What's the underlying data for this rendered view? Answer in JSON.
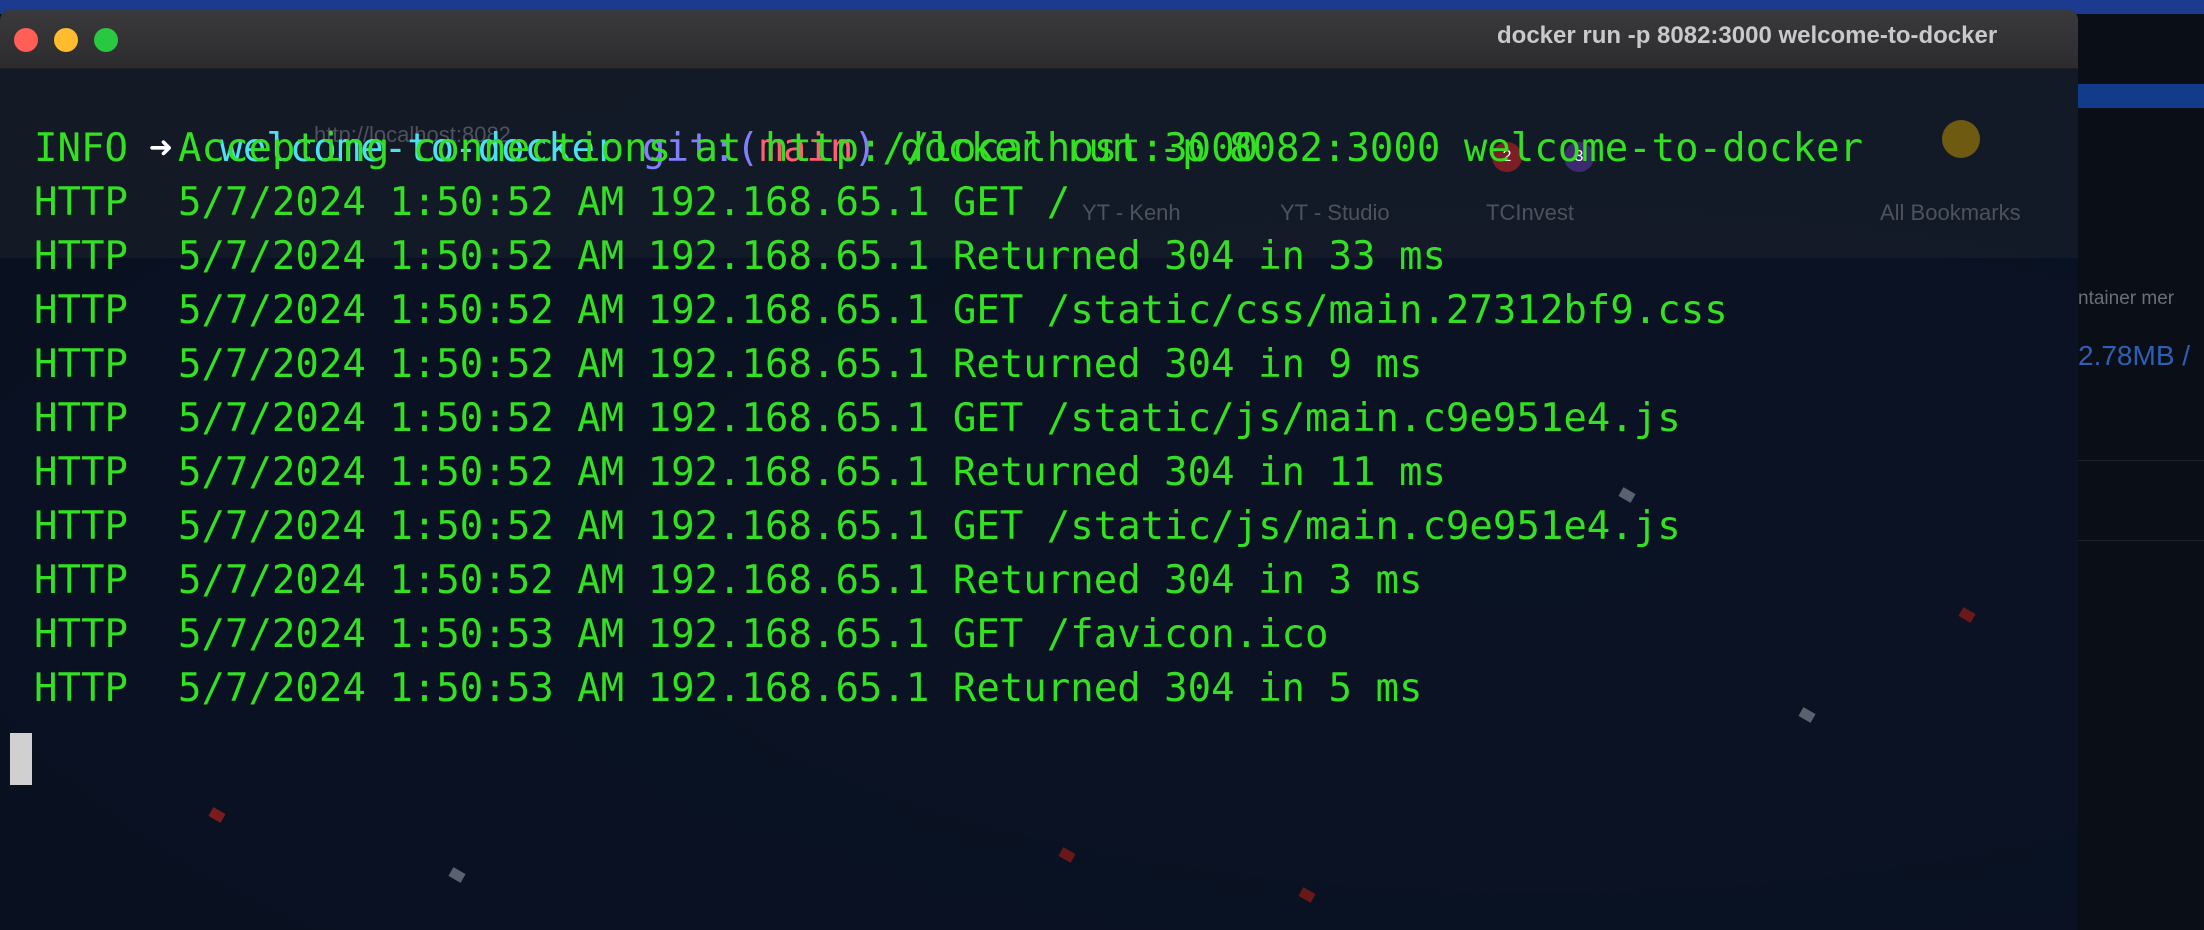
{
  "window": {
    "title": "docker run -p 8082:3000 welcome-to-docker"
  },
  "prompt": {
    "arrow": "➜",
    "directory": "welcome-to-docker",
    "git_label": "git:",
    "branch_open": "(",
    "branch": "main",
    "branch_close": ")",
    "command": "docker run -p 8082:3000 welcome-to-docker"
  },
  "log_lines": [
    {
      "level": "INFO",
      "message": "Accepting connections at http://localhost:3000"
    },
    {
      "level": "HTTP",
      "message": "5/7/2024 1:50:52 AM 192.168.65.1 GET /"
    },
    {
      "level": "HTTP",
      "message": "5/7/2024 1:50:52 AM 192.168.65.1 Returned 304 in 33 ms"
    },
    {
      "level": "HTTP",
      "message": "5/7/2024 1:50:52 AM 192.168.65.1 GET /static/css/main.27312bf9.css"
    },
    {
      "level": "HTTP",
      "message": "5/7/2024 1:50:52 AM 192.168.65.1 Returned 304 in 9 ms"
    },
    {
      "level": "HTTP",
      "message": "5/7/2024 1:50:52 AM 192.168.65.1 GET /static/js/main.c9e951e4.js"
    },
    {
      "level": "HTTP",
      "message": "5/7/2024 1:50:52 AM 192.168.65.1 Returned 304 in 11 ms"
    },
    {
      "level": "HTTP",
      "message": "5/7/2024 1:50:52 AM 192.168.65.1 GET /static/js/main.c9e951e4.js"
    },
    {
      "level": "HTTP",
      "message": "5/7/2024 1:50:52 AM 192.168.65.1 Returned 304 in 3 ms"
    },
    {
      "level": "HTTP",
      "message": "5/7/2024 1:50:53 AM 192.168.65.1 GET /favicon.ico"
    },
    {
      "level": "HTTP",
      "message": "5/7/2024 1:50:53 AM 192.168.65.1 Returned 304 in 5 ms"
    }
  ],
  "background": {
    "address_bar_text": "http://localhost:8082",
    "bookmarks": [
      "YT - Kenh",
      "YT - Studio",
      "TCInvest",
      "All Bookmarks"
    ],
    "badges": [
      "2",
      "3"
    ],
    "right_panel_label": "ntainer mer",
    "right_panel_value": "2.78MB /"
  },
  "colors": {
    "prompt_dir": "#4de0f0",
    "git": "#8080ff",
    "branch": "#ff5f72",
    "output_text": "#33e022",
    "terminal_bg": "#0a1222",
    "close": "#ff5f57",
    "minimize": "#febc2e",
    "maximize": "#28c840"
  },
  "icons": [
    "close-icon",
    "minimize-icon",
    "maximize-icon",
    "prompt-arrow-icon",
    "cursor-block"
  ]
}
